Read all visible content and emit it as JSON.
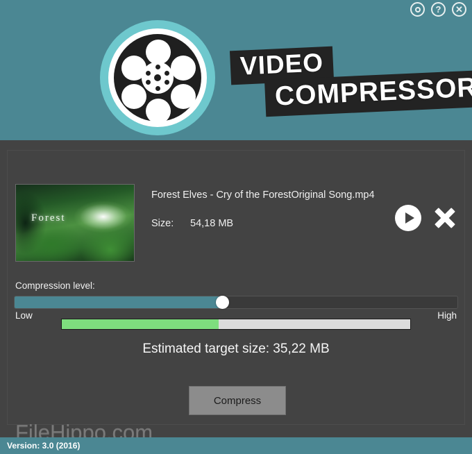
{
  "titlebar": {
    "icons": [
      {
        "name": "record-icon",
        "glyph": ""
      },
      {
        "name": "help-icon",
        "glyph": "?"
      },
      {
        "name": "close-icon",
        "glyph": "✕"
      }
    ]
  },
  "header": {
    "title_line1": "VIDEO",
    "title_line2": "COMPRESSOR",
    "logo_name": "film-reel-logo",
    "background_color": "#4b8793",
    "accent_color": "#6ec8cd"
  },
  "file": {
    "name": "Forest Elves - Cry of the ForestOriginal Song.mp4",
    "size_label": "Size:",
    "size_value": "54,18 MB",
    "thumbnail_caption": "Forest",
    "play_label": "Play",
    "remove_label": "Remove"
  },
  "compression": {
    "label": "Compression level:",
    "low_label": "Low",
    "high_label": "High",
    "slider_percent": 47,
    "progress_percent": 45,
    "progress_color": "#7ede7e",
    "estimated_label": "Estimated target size:",
    "estimated_value": "35,22 MB",
    "estimated_full": "Estimated target size:  35,22 MB"
  },
  "actions": {
    "compress_label": "Compress"
  },
  "watermark": {
    "text": "FileHippo.com"
  },
  "statusbar": {
    "text": "Version:  3.0 (2016)"
  }
}
